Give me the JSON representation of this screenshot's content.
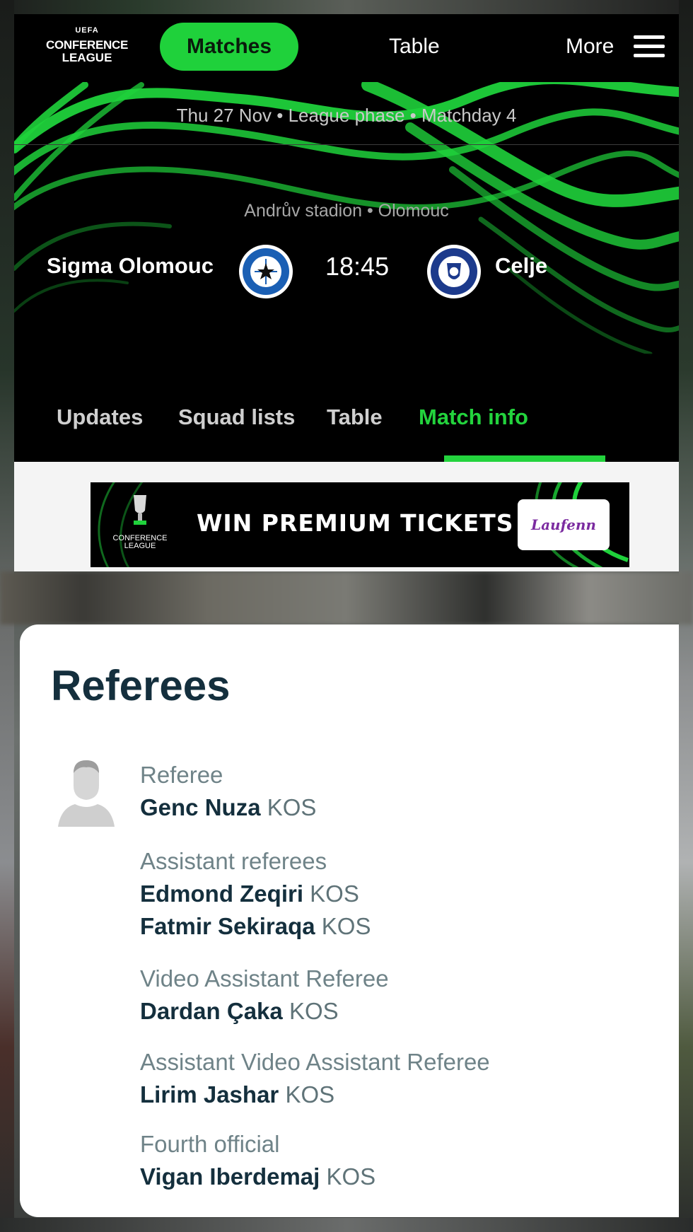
{
  "topbar": {
    "logo_line1": "UEFA",
    "logo_line2": "CONFERENCE",
    "logo_line3": "LEAGUE",
    "nav_matches": "Matches",
    "nav_table": "Table",
    "nav_more": "More"
  },
  "match": {
    "date": "Thu 27 Nov",
    "phase": "League phase",
    "matchday": "Matchday 4",
    "meta_text": "Thu 27 Nov • League phase • Matchday 4",
    "venue": "Andrův stadion • Olomouc",
    "home_team": "Sigma Olomouc",
    "away_team": "Celje",
    "kickoff": "18:45"
  },
  "tabs": [
    {
      "label": "Updates"
    },
    {
      "label": "Squad lists"
    },
    {
      "label": "Table"
    },
    {
      "label": "Match info",
      "active": true
    }
  ],
  "ad": {
    "logo_text": "CONFERENCE LEAGUE",
    "headline": "WIN PREMIUM TICKETS",
    "brand": "Laufenn"
  },
  "referees": {
    "title": "Referees",
    "groups": [
      {
        "role": "Referee",
        "people": [
          {
            "name": "Genc Nuza",
            "country": "KOS"
          }
        ]
      },
      {
        "role": "Assistant referees",
        "people": [
          {
            "name": "Edmond Zeqiri",
            "country": "KOS"
          },
          {
            "name": "Fatmir Sekiraqa",
            "country": "KOS"
          }
        ]
      },
      {
        "role": "Video Assistant Referee",
        "people": [
          {
            "name": "Dardan Çaka",
            "country": "KOS"
          }
        ]
      },
      {
        "role": "Assistant Video Assistant Referee",
        "people": [
          {
            "name": "Lirim Jashar",
            "country": "KOS"
          }
        ]
      },
      {
        "role": "Fourth official",
        "people": [
          {
            "name": "Vigan Iberdemaj",
            "country": "KOS"
          }
        ]
      }
    ]
  },
  "colors": {
    "accent_green": "#23d33d",
    "header_bg": "#000000",
    "title_navy": "#142f3d",
    "crest_home_blue": "#1a5fb4",
    "crest_away_blue": "#1c3a8c"
  }
}
